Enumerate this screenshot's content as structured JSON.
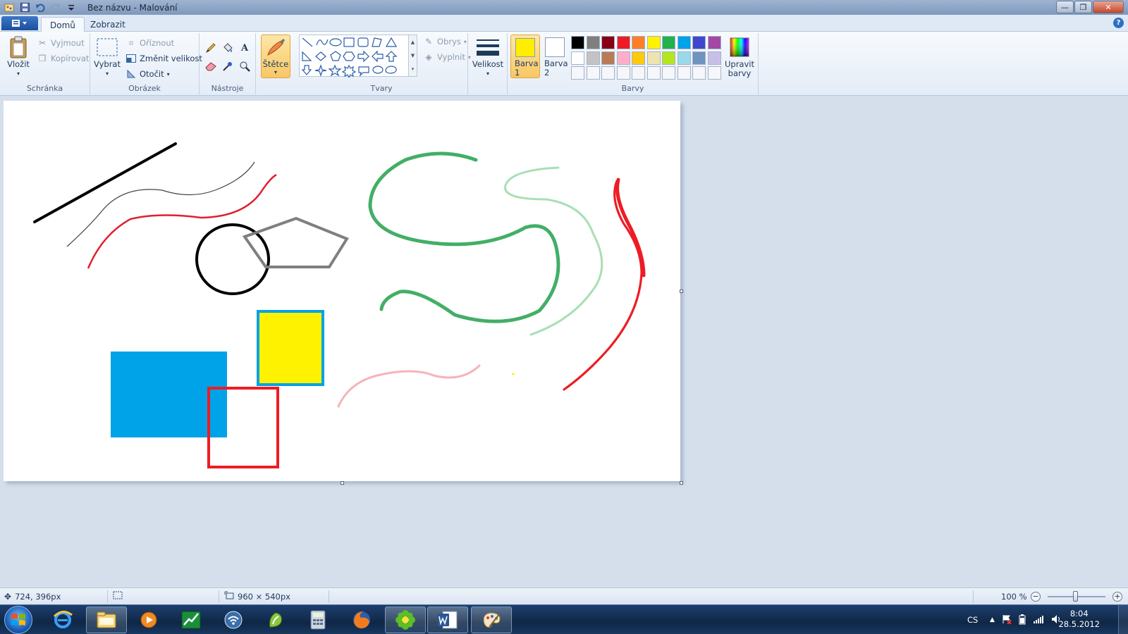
{
  "window": {
    "title": "Bez názvu - Malování",
    "controls": {
      "minimize": "—",
      "maximize": "❐",
      "close": "✕"
    }
  },
  "quick_access": [
    "paint-icon",
    "save-icon",
    "undo-icon",
    "redo-icon",
    "customize-dropdown-icon"
  ],
  "tabs": [
    {
      "label": "Domů",
      "active": true
    },
    {
      "label": "Zobrazit",
      "active": false
    }
  ],
  "help_label": "?",
  "ribbon": {
    "clipboard": {
      "label": "Schránka",
      "paste": "Vložit",
      "cut": "Vyjmout",
      "copy": "Kopírovat"
    },
    "image": {
      "label": "Obrázek",
      "select": "Vybrat",
      "crop": "Oříznout",
      "resize": "Změnit velikost",
      "rotate": "Otočit"
    },
    "tools": {
      "label": "Nástroje",
      "items": [
        "pencil-icon",
        "fill-icon",
        "text-icon",
        "eraser-icon",
        "color-picker-icon",
        "magnifier-icon"
      ]
    },
    "brushes": {
      "label": "Štětce"
    },
    "shapes": {
      "label": "Tvary",
      "outline": "Obrys",
      "fill": "Vyplnit"
    },
    "size": {
      "label": "Velikost"
    },
    "colors": {
      "label": "Barvy",
      "color1_label": "Barva 1",
      "color2_label": "Barva 2",
      "color1": "#ffee00",
      "color2": "#ffffff",
      "edit_label": "Upravit barvy",
      "palette_row1": [
        "#000000",
        "#7f7f7f",
        "#880015",
        "#ed1c24",
        "#ff7f27",
        "#fff200",
        "#22b14c",
        "#00a2e8",
        "#3f48cc",
        "#a349a4"
      ],
      "palette_row2": [
        "#ffffff",
        "#c3c3c3",
        "#b97a57",
        "#ffaec9",
        "#ffc90e",
        "#efe4b0",
        "#b5e61d",
        "#99d9ea",
        "#7092be",
        "#c8bfe7"
      ],
      "palette_row3": [
        "#f5f7fa",
        "#f5f7fa",
        "#f5f7fa",
        "#f5f7fa",
        "#f5f7fa",
        "#f5f7fa",
        "#f5f7fa",
        "#f5f7fa",
        "#f5f7fa",
        "#f5f7fa"
      ]
    }
  },
  "status": {
    "cursor_pos": "724, 396px",
    "canvas_size": "960 × 540px",
    "zoom": "100 %"
  },
  "taskbar": {
    "apps": [
      "internet-explorer-icon",
      "explorer-icon",
      "media-player-icon",
      "graph-app-icon",
      "wireless-icon",
      "app-icon",
      "calculator-icon",
      "firefox-icon",
      "icq-icon",
      "word-icon",
      "paint-app-icon"
    ],
    "language": "CS",
    "time": "8:04",
    "date": "28.5.2012"
  }
}
